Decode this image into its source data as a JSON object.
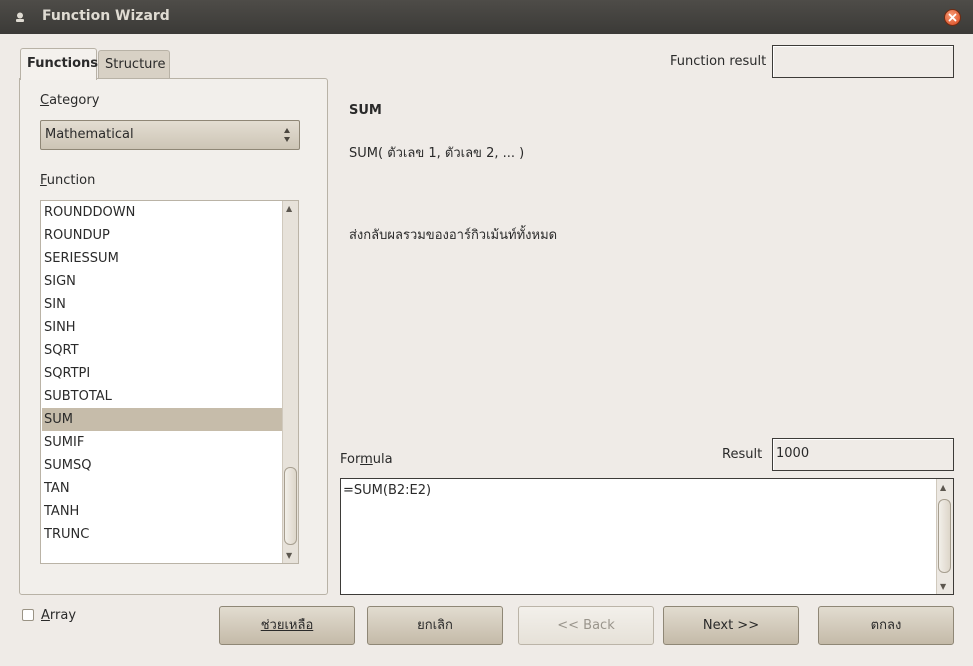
{
  "window": {
    "title": "Function Wizard"
  },
  "tabs": [
    {
      "label": "Functions"
    },
    {
      "label": "Structure"
    }
  ],
  "functions_panel": {
    "category_label": "Category",
    "category_selected": "Mathematical",
    "function_label": "Function",
    "functions": [
      "ROUNDDOWN",
      "ROUNDUP",
      "SERIESSUM",
      "SIGN",
      "SIN",
      "SINH",
      "SQRT",
      "SQRTPI",
      "SUBTOTAL",
      "SUM",
      "SUMIF",
      "SUMSQ",
      "TAN",
      "TANH",
      "TRUNC"
    ],
    "selected_function": "SUM"
  },
  "details": {
    "function_result_label": "Function result",
    "function_result_value": "",
    "name": "SUM",
    "signature": "SUM( ตัวเลข 1, ตัวเลข 2, ...   )",
    "description": "ส่งกลับผลรวมของอาร์กิวเม้นท์ทั้งหมด"
  },
  "formula": {
    "label": "Formula",
    "result_label": "Result",
    "result_value": "1000",
    "value": "=SUM(B2:E2)"
  },
  "array": {
    "label": "Array",
    "checked": false
  },
  "buttons": {
    "help": "ช่วยเหลือ",
    "cancel": "ยกเลิก",
    "back": "<< Back",
    "next": "Next >>",
    "ok": "ตกลง"
  },
  "colors": {
    "titlebar": "#3b3a37",
    "selection": "#c6bcaa",
    "close": "#d8461c"
  }
}
